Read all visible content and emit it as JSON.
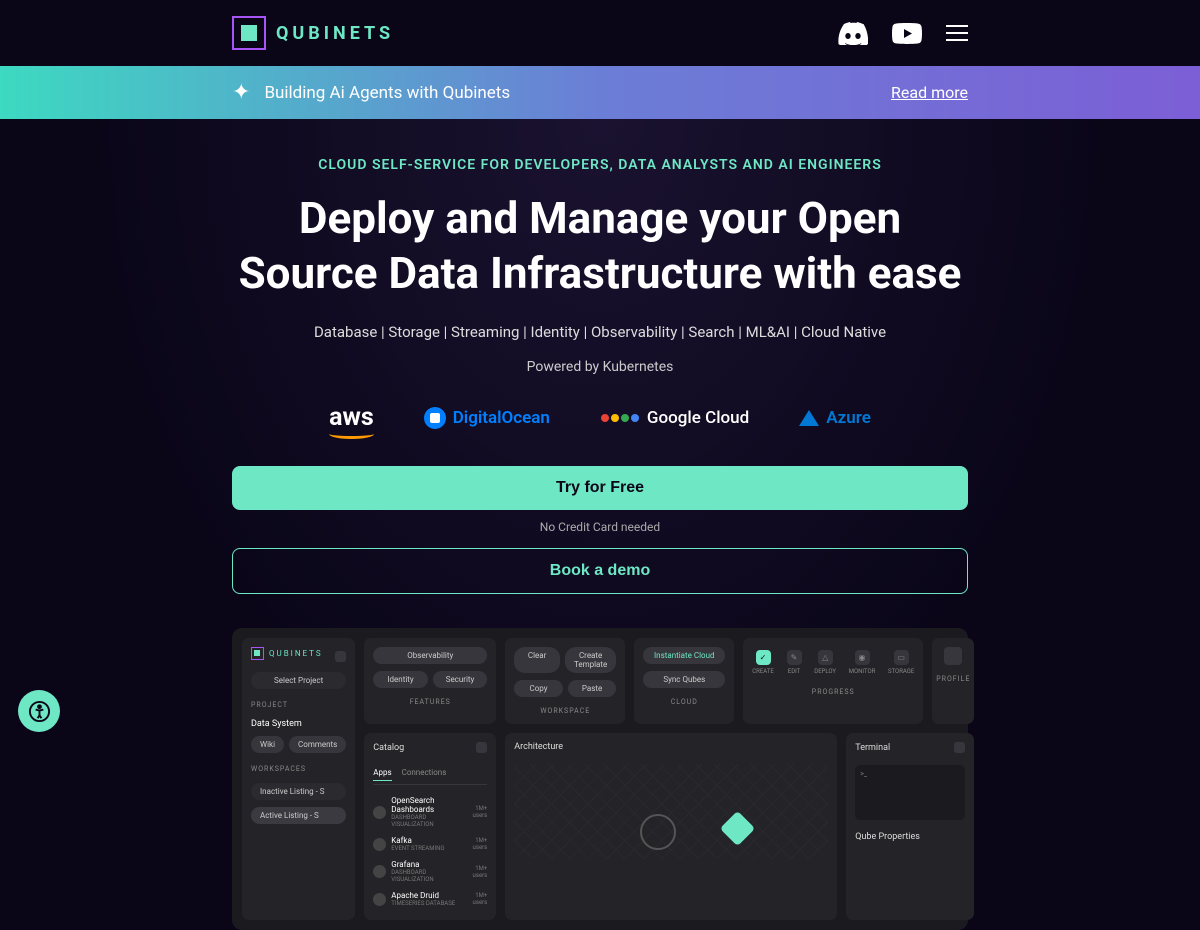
{
  "nav": {
    "brand": "QUBINETS"
  },
  "banner": {
    "text": "Building Ai Agents with Qubinets",
    "link": "Read more"
  },
  "hero": {
    "eyebrow": "CLOUD SELF-SERVICE FOR DEVELOPERS, DATA ANALYSTS AND AI ENGINEERS",
    "headline": "Deploy and Manage your Open Source Data Infrastructure with ease",
    "subhead": "Database | Storage | Streaming | Identity | Observability | Search | ML&AI | Cloud Native",
    "powered": "Powered by Kubernetes",
    "clouds": {
      "aws": "aws",
      "do": "DigitalOcean",
      "gc": "Google Cloud",
      "azure": "Azure"
    },
    "cta_primary": "Try for Free",
    "caption": "No Credit Card needed",
    "cta_secondary": "Book a demo"
  },
  "app": {
    "brand": "QUBINETS",
    "select_project": "Select Project",
    "project_label": "PROJECT",
    "project_name": "Data System",
    "wiki": "Wiki",
    "comments": "Comments",
    "workspaces_label": "WORKSPACES",
    "ws1": "Inactive Listing - S",
    "ws2": "Active Listing - S",
    "features": {
      "observability": "Observability",
      "identity": "Identity",
      "security": "Security",
      "label": "FEATURES"
    },
    "workspace": {
      "clear": "Clear",
      "create_template": "Create Template",
      "copy": "Copy",
      "paste": "Paste",
      "label": "WORKSPACE"
    },
    "cloud": {
      "instantiate": "Instantiate Cloud",
      "sync": "Sync Qubes",
      "label": "CLOUD"
    },
    "catalog": {
      "title": "Catalog",
      "tab_apps": "Apps",
      "tab_connections": "Connections",
      "items": [
        {
          "name": "OpenSearch Dashboards",
          "sub": "DASHBOARD VISUALIZATION",
          "meta1": "1M+",
          "meta2": "users"
        },
        {
          "name": "Kafka",
          "sub": "EVENT STREAMING",
          "meta1": "1M+",
          "meta2": "users"
        },
        {
          "name": "Grafana",
          "sub": "DASHBOARD VISUALIZATION",
          "meta1": "1M+",
          "meta2": "users"
        },
        {
          "name": "Apache Druid",
          "sub": "TIMESERIES DATABASE",
          "meta1": "1M+",
          "meta2": "users"
        }
      ]
    },
    "architecture": {
      "title": "Architecture",
      "qube": "Qube Properties"
    },
    "progress": {
      "create": "CREATE",
      "edit": "EDIT",
      "deploy": "DEPLOY",
      "monitor": "MONITOR",
      "storage": "STORAGE",
      "label": "PROGRESS"
    },
    "profile": "PROFILE",
    "terminal": {
      "title": "Terminal",
      "cursor": ">_"
    }
  }
}
